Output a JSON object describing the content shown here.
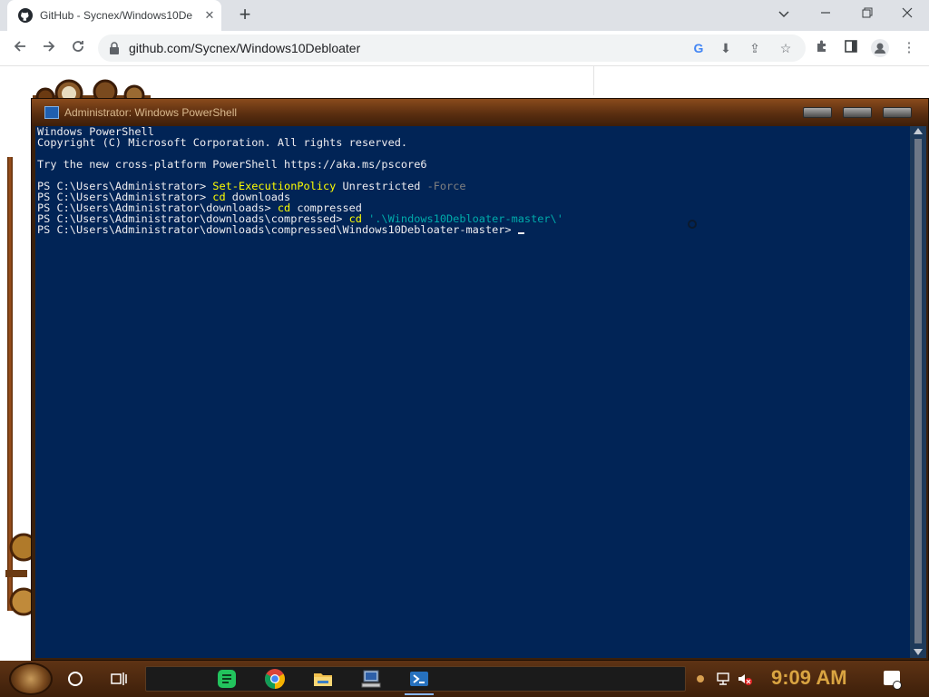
{
  "browser": {
    "tab_title": "GitHub - Sycnex/Windows10De",
    "url": "github.com/Sycnex/Windows10Debloater"
  },
  "powershell": {
    "title": "Administrator: Windows PowerShell",
    "lines": [
      {
        "plain": "Windows PowerShell"
      },
      {
        "plain": "Copyright (C) Microsoft Corporation. All rights reserved."
      },
      {
        "plain": ""
      },
      {
        "plain": "Try the new cross-platform PowerShell https://aka.ms/pscore6"
      },
      {
        "plain": ""
      },
      {
        "prompt": "PS C:\\Users\\Administrator> ",
        "cmd": "Set-ExecutionPolicy",
        "arg": " Unrestricted",
        "param": " -Force"
      },
      {
        "prompt": "PS C:\\Users\\Administrator> ",
        "cmd": "cd",
        "arg": " downloads"
      },
      {
        "prompt": "PS C:\\Users\\Administrator\\downloads> ",
        "cmd": "cd",
        "arg": " compressed"
      },
      {
        "prompt": "PS C:\\Users\\Administrator\\downloads\\compressed> ",
        "cmd": "cd",
        "str": " '.\\Windows10Debloater-master\\'"
      },
      {
        "prompt": "PS C:\\Users\\Administrator\\downloads\\compressed\\Windows10Debloater-master> ",
        "cursor": true
      }
    ]
  },
  "taskbar": {
    "clock": "9:09 AM",
    "apps": [
      "sheets-icon",
      "chrome-icon",
      "file-explorer-icon",
      "computer-icon",
      "powershell-icon"
    ]
  },
  "colors": {
    "console_bg": "#012456",
    "console_fg": "#eeedf0",
    "command": "#ffff00",
    "parameter": "#808080",
    "string": "#00abab",
    "clock": "#d9a441"
  }
}
